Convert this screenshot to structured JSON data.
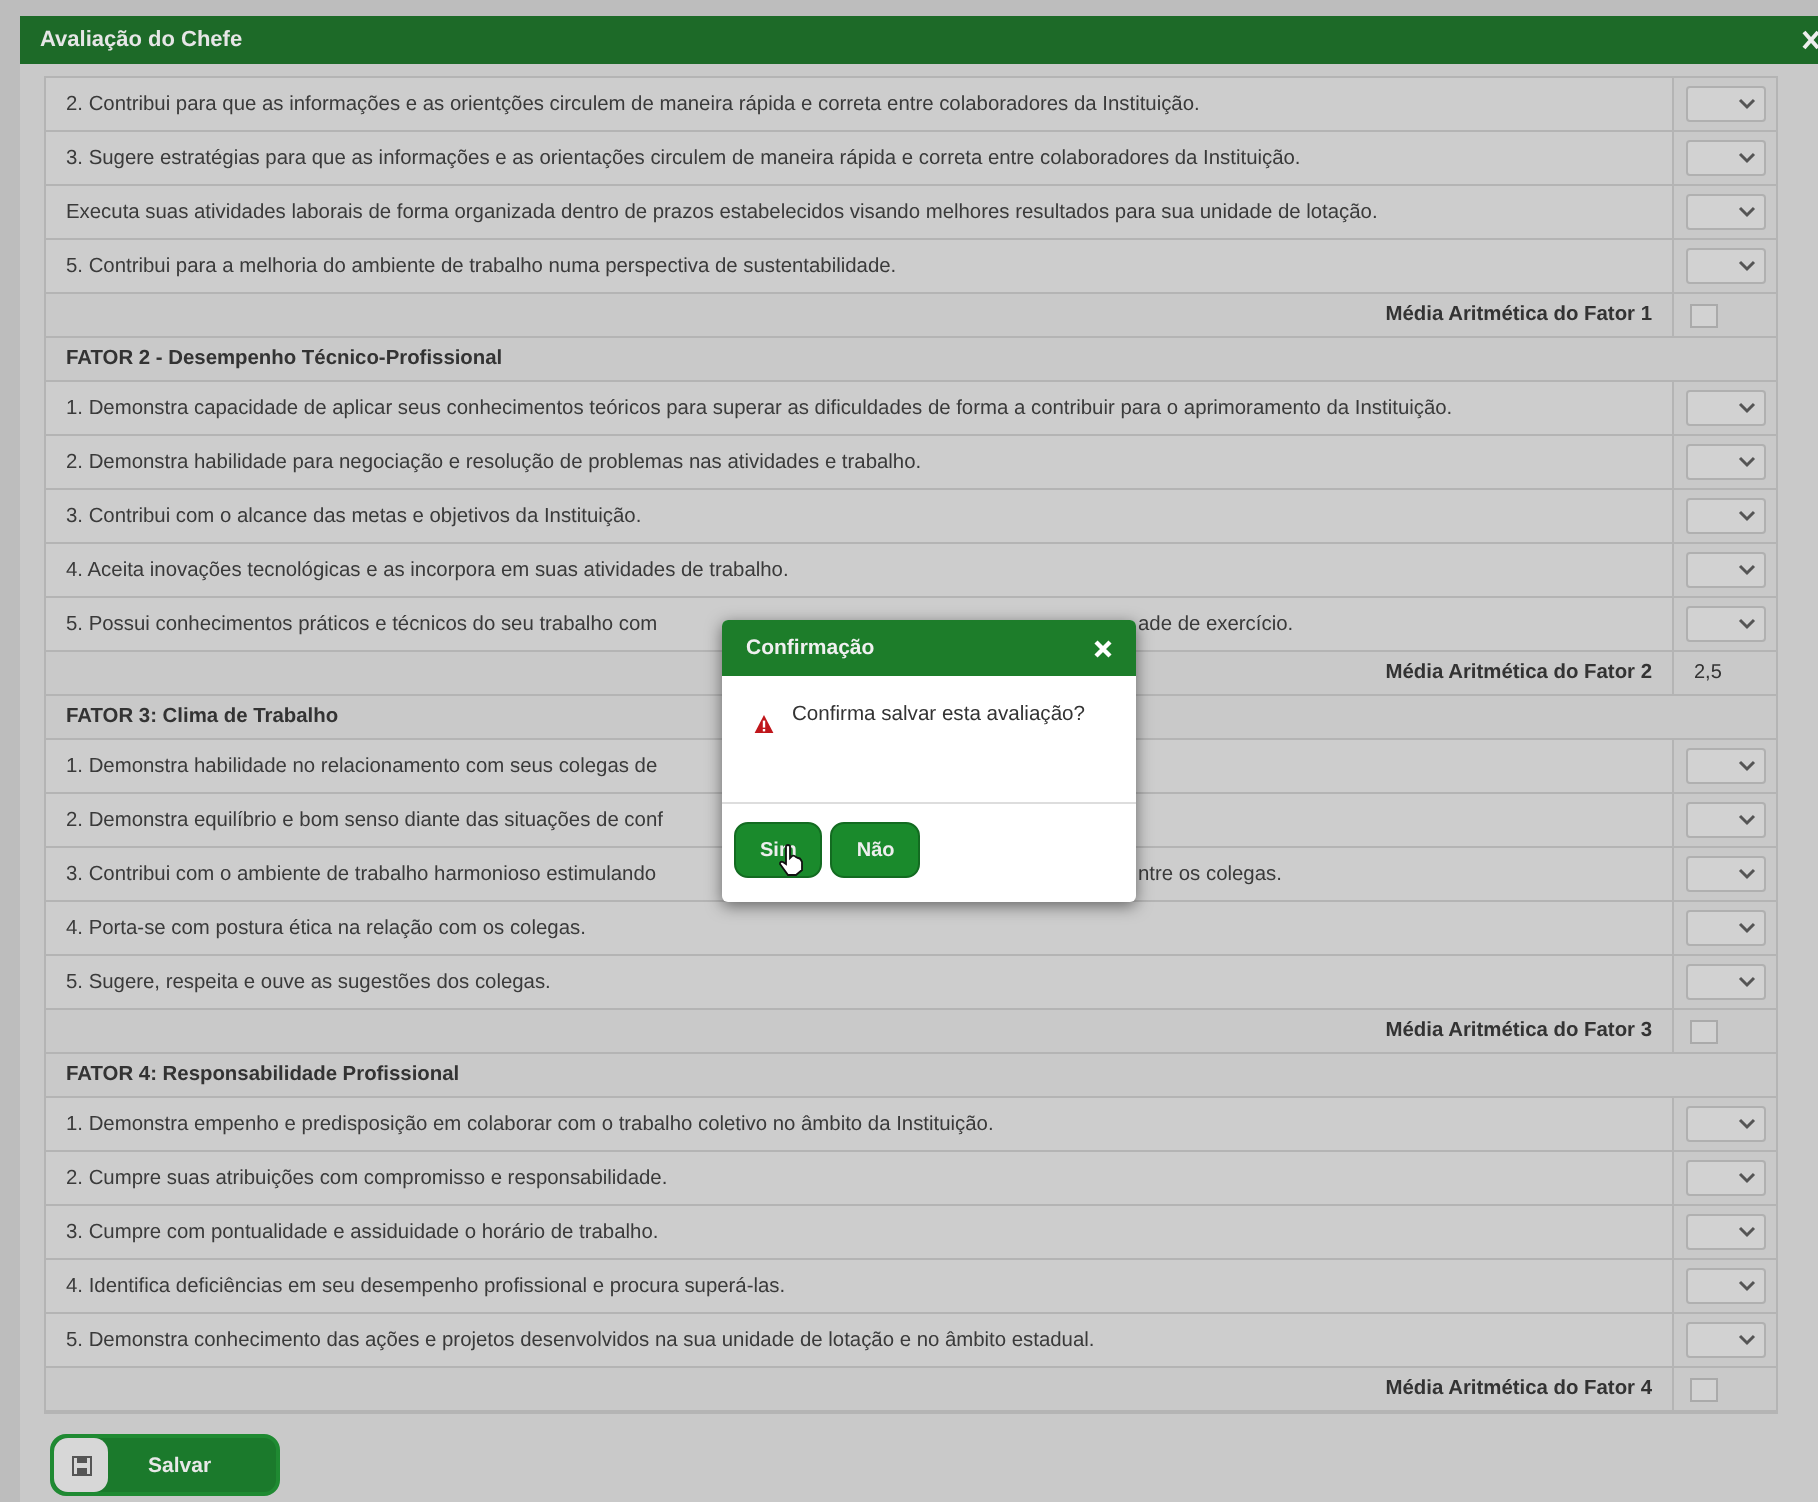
{
  "window": {
    "title": "Avaliação do Chefe"
  },
  "sections": [
    {
      "items": [
        {
          "text": "2. Contribui para que as informações e as orientções circulem de maneira rápida e correta entre colaboradores da Instituição."
        },
        {
          "text": "3. Sugere estratégias para que as informações e as orientações circulem de maneira rápida e correta entre colaboradores da Instituição."
        },
        {
          "text": "Executa suas atividades laborais de forma organizada dentro de prazos estabelecidos visando melhores resultados para sua unidade de lotação."
        },
        {
          "text": "5. Contribui para a melhoria do ambiente de trabalho numa perspectiva de sustentabilidade."
        }
      ],
      "average_label": "Média Aritmética do Fator 1"
    },
    {
      "heading": "FATOR 2 - Desempenho Técnico-Profissional",
      "items": [
        {
          "text": "1. Demonstra capacidade de aplicar seus conhecimentos teóricos para superar as dificuldades de forma a contribuir para o aprimoramento da Instituição."
        },
        {
          "text": "2. Demonstra habilidade para negociação e resolução de problemas nas atividades e trabalho."
        },
        {
          "text": "3. Contribui com o alcance das metas e objetivos da Instituição."
        },
        {
          "text": "4. Aceita inovações tecnológicas e as incorpora em suas atividades de trabalho."
        },
        {
          "text": "5. Possui conhecimentos práticos e técnicos do seu trabalho com",
          "text_after": "ade de exercício."
        }
      ],
      "average_label": "Média Aritmética do Fator 2",
      "average": "2,5"
    },
    {
      "heading": "FATOR 3: Clima de Trabalho",
      "items": [
        {
          "text": "1. Demonstra habilidade no relacionamento com seus colegas de"
        },
        {
          "text": "2. Demonstra equilíbrio e bom senso diante das situações de conf"
        },
        {
          "text": "3. Contribui com o ambiente de trabalho harmonioso estimulando",
          "text_after": "ntre os colegas."
        },
        {
          "text": "4. Porta-se com postura ética na relação com os colegas."
        },
        {
          "text": "5. Sugere, respeita e ouve as sugestões dos colegas."
        }
      ],
      "average_label": "Média Aritmética do Fator 3"
    },
    {
      "heading": "FATOR 4: Responsabilidade Profissional",
      "items": [
        {
          "text": "1. Demonstra empenho e predisposição em colaborar com o trabalho coletivo no âmbito da Instituição."
        },
        {
          "text": "2. Cumpre suas atribuições com compromisso e responsabilidade."
        },
        {
          "text": "3. Cumpre com pontualidade e assiduidade o horário de trabalho."
        },
        {
          "text": "4. Identifica deficiências em seu desempenho profissional e procura superá-las."
        },
        {
          "text": "5. Demonstra conhecimento das ações e projetos desenvolvidos na sua unidade de lotação e no âmbito estadual."
        }
      ],
      "average_label": "Média Aritmética do Fator 4"
    }
  ],
  "save_button": {
    "label": "Salvar"
  },
  "dialog": {
    "title": "Confirmação",
    "message": "Confirma salvar esta avaliação?",
    "buttons": [
      {
        "label": "Sim"
      },
      {
        "label": "Não"
      }
    ]
  }
}
